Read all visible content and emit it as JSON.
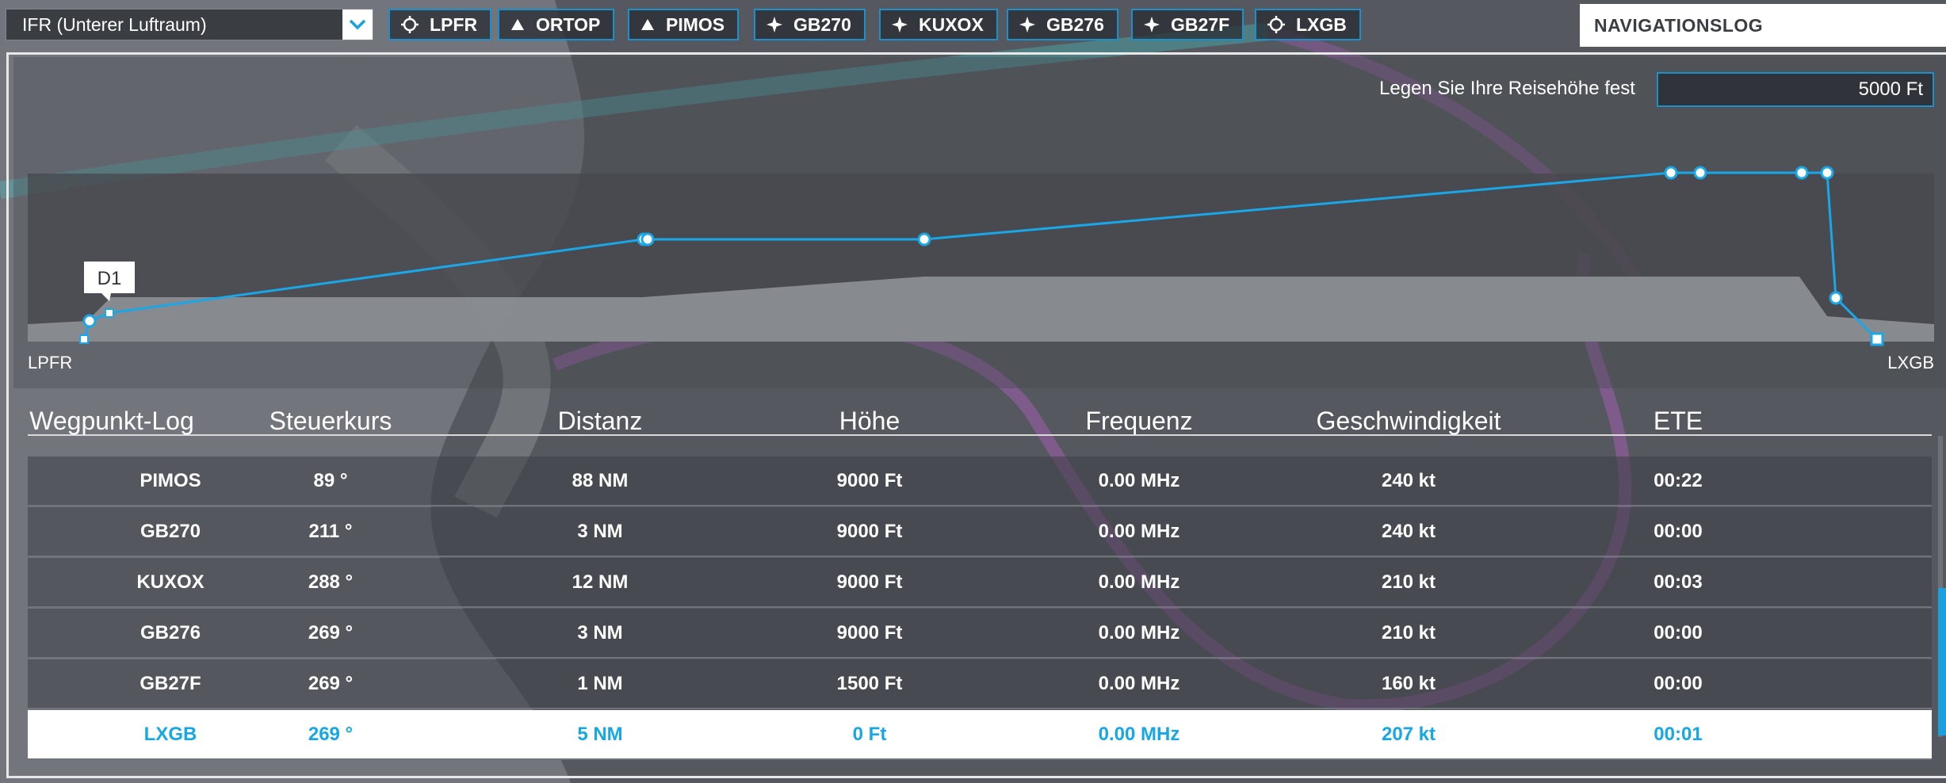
{
  "route_select": {
    "value": "IFR (Unterer Luftraum)",
    "dropdown_icon": "chevron-down-icon"
  },
  "waypoints": [
    {
      "label": "LPFR",
      "icon": "airport-icon"
    },
    {
      "label": "ORTOP",
      "icon": "triangle-icon"
    },
    {
      "label": "PIMOS",
      "icon": "triangle-icon"
    },
    {
      "label": "GB270",
      "icon": "star-icon"
    },
    {
      "label": "KUXOX",
      "icon": "star-icon"
    },
    {
      "label": "GB276",
      "icon": "star-icon"
    },
    {
      "label": "GB27F",
      "icon": "star-icon"
    },
    {
      "label": "LXGB",
      "icon": "airport-icon"
    }
  ],
  "navlog": {
    "title": "NAVIGATIONSLOG"
  },
  "cruise": {
    "label": "Legen Sie Ihre Reisehöhe fest",
    "value": "5000 Ft"
  },
  "profile": {
    "departure": "LPFR",
    "arrival": "LXGB",
    "marker": "D1"
  },
  "table": {
    "headers": [
      "Wegpunkt-Log",
      "Steuerkurs",
      "Distanz",
      "Höhe",
      "Frequenz",
      "Geschwindigkeit",
      "ETE"
    ],
    "rows": [
      [
        "PIMOS",
        "89 °",
        "88 NM",
        "9000 Ft",
        "0.00 MHz",
        "240 kt",
        "00:22"
      ],
      [
        "GB270",
        "211 °",
        "3 NM",
        "9000 Ft",
        "0.00 MHz",
        "240 kt",
        "00:00"
      ],
      [
        "KUXOX",
        "288 °",
        "12 NM",
        "9000 Ft",
        "0.00 MHz",
        "210 kt",
        "00:03"
      ],
      [
        "GB276",
        "269 °",
        "3 NM",
        "9000 Ft",
        "0.00 MHz",
        "210 kt",
        "00:00"
      ],
      [
        "GB27F",
        "269 °",
        "1 NM",
        "1500 Ft",
        "0.00 MHz",
        "160 kt",
        "00:00"
      ],
      [
        "LXGB",
        "269 °",
        "5 NM",
        "0 Ft",
        "0.00 MHz",
        "207 kt",
        "00:01"
      ]
    ],
    "active_row": 5
  },
  "colors": {
    "accent": "#1aa0e0",
    "path": "#1aa7e8"
  }
}
